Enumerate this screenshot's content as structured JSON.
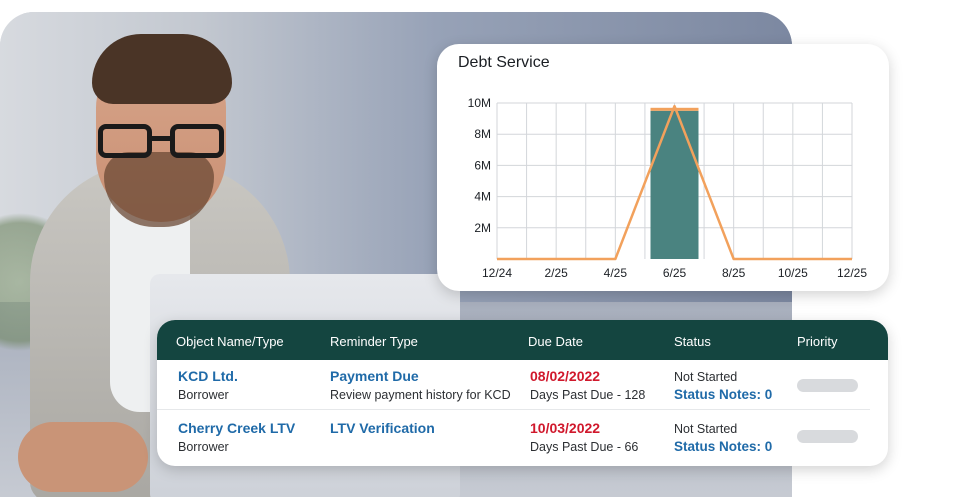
{
  "chart": {
    "title": "Debt Service",
    "chart_data": {
      "type": "bar",
      "title": "Debt Service",
      "x_ticks": [
        "12/24",
        "2/25",
        "4/25",
        "6/25",
        "8/25",
        "10/25",
        "12/25"
      ],
      "y_ticks": [
        "2M",
        "4M",
        "6M",
        "8M",
        "10M"
      ],
      "ylim": [
        0,
        10000000
      ],
      "grid": true,
      "bar": {
        "category": "6/25",
        "value": 9500000
      },
      "line": {
        "points": [
          [
            "12/24",
            0
          ],
          [
            "4/25",
            0
          ],
          [
            "6/25",
            9800000
          ],
          [
            "8/25",
            0
          ],
          [
            "12/25",
            0
          ]
        ]
      },
      "colors": {
        "bar": "#4a8380",
        "line": "#f2a15c",
        "bar_cap": "#f2a15c",
        "grid": "#d3d6da"
      }
    }
  },
  "table": {
    "headers": {
      "object": "Object Name/Type",
      "reminder": "Reminder Type",
      "due": "Due Date",
      "status": "Status",
      "priority": "Priority"
    },
    "rows": [
      {
        "object_name": "KCD Ltd.",
        "object_type": "Borrower",
        "reminder": "Payment Due",
        "reminder_detail": "Review payment history for KCD",
        "due_date": "08/02/2022",
        "days_past_due": "Days Past Due - 128",
        "status": "Not Started",
        "status_notes": "Status Notes: 0"
      },
      {
        "object_name": "Cherry Creek LTV",
        "object_type": "Borrower",
        "reminder": "LTV Verification",
        "reminder_detail": "",
        "due_date": "10/03/2022",
        "days_past_due": "Days Past Due - 66",
        "status": "Not Started",
        "status_notes": "Status Notes: 0"
      }
    ]
  },
  "colors": {
    "header_bg": "#144540",
    "link": "#1f6aa8",
    "due_red": "#d0182c"
  }
}
